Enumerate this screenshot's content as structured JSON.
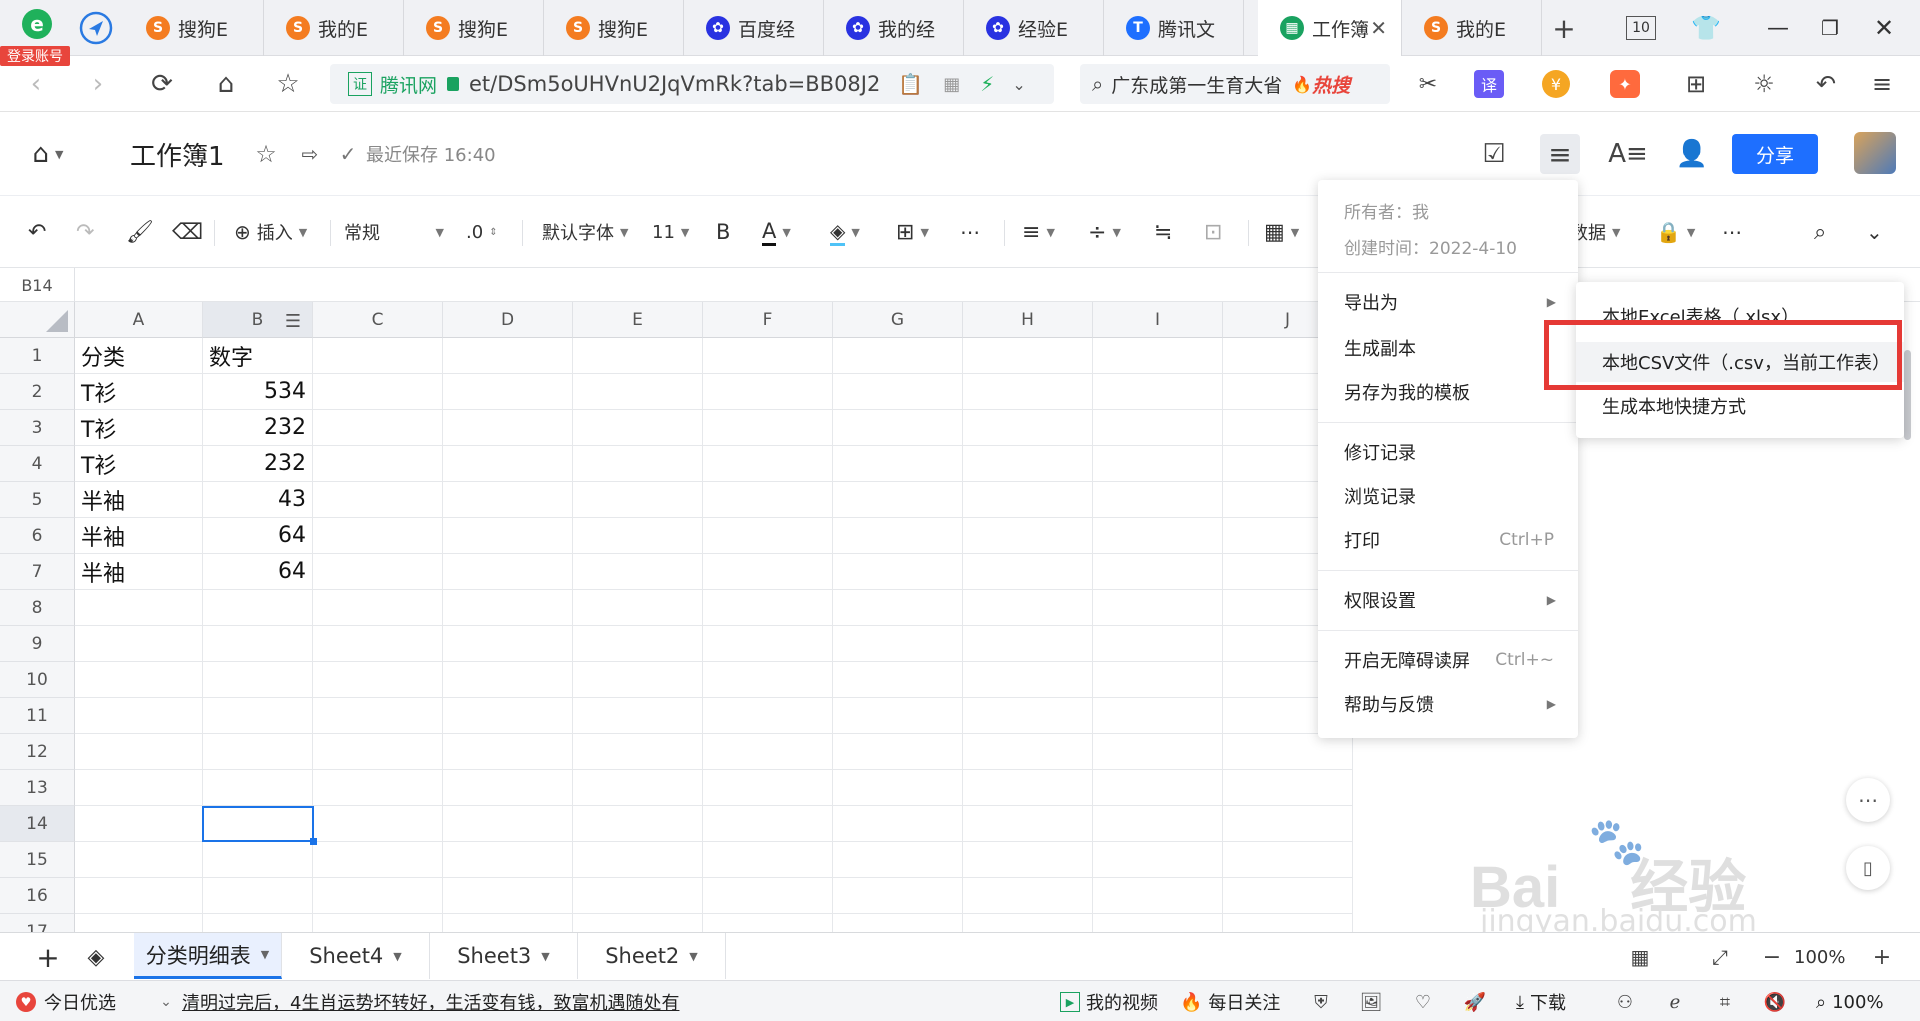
{
  "browser": {
    "login_badge": "登录账号",
    "tabs": [
      {
        "label": "搜狗E",
        "icon_color": "#f47c20",
        "icon_text": "S"
      },
      {
        "label": "我的E",
        "icon_color": "#f47c20",
        "icon_text": "S"
      },
      {
        "label": "搜狗E",
        "icon_color": "#f47c20",
        "icon_text": "S"
      },
      {
        "label": "搜狗E",
        "icon_color": "#f47c20",
        "icon_text": "S"
      },
      {
        "label": "百度经",
        "icon_color": "#2932e1",
        "icon_text": "✿"
      },
      {
        "label": "我的经",
        "icon_color": "#2932e1",
        "icon_text": "✿"
      },
      {
        "label": "经验E",
        "icon_color": "#2932e1",
        "icon_text": "✿"
      },
      {
        "label": "腾讯文",
        "icon_color": "#1e6fff",
        "icon_text": "T"
      },
      {
        "label": "工作簿",
        "icon_color": "#1aa260",
        "icon_text": "▦",
        "active": true
      },
      {
        "label": "我的E",
        "icon_color": "#f47c20",
        "icon_text": "S"
      }
    ],
    "tab_count": "10",
    "url_cert": "证",
    "url_site": "腾讯网",
    "url_text": "et/DSm5oUHVnU2JqVmRk?tab=BB08J2",
    "search_text": "广东成第一生育大省",
    "search_hot": "热搜",
    "translate_label": "译"
  },
  "doc": {
    "title": "工作簿1",
    "save_status": "最近保存 16:40",
    "share_label": "分享"
  },
  "toolbar": {
    "insert_label": "插入",
    "format_label": "常规",
    "decimal_label": ".0",
    "font_label": "默认字体",
    "size_label": "11",
    "bold_label": "B",
    "font_color_label": "A",
    "data_label": "数据"
  },
  "formula_bar": {
    "cell_ref": "B14"
  },
  "grid": {
    "columns": [
      "A",
      "B",
      "C",
      "D",
      "E",
      "F",
      "G",
      "H",
      "I",
      "J"
    ],
    "rows": [
      "1",
      "2",
      "3",
      "4",
      "5",
      "6",
      "7",
      "8",
      "9",
      "10",
      "11",
      "12",
      "13",
      "14",
      "15",
      "16",
      "17"
    ],
    "cells": [
      [
        "分类",
        "数字"
      ],
      [
        "T衫",
        "534"
      ],
      [
        "T衫",
        "232"
      ],
      [
        "T衫",
        "232"
      ],
      [
        "半袖",
        "43"
      ],
      [
        "半袖",
        "64"
      ],
      [
        "半袖",
        "64"
      ]
    ]
  },
  "main_menu": {
    "owner": "所有者：我",
    "created": "创建时间：2022-4-10",
    "items": [
      {
        "label": "导出为",
        "has_submenu": true
      },
      {
        "label": "生成副本"
      },
      {
        "label": "另存为我的模板"
      },
      {
        "label": "修订记录"
      },
      {
        "label": "浏览记录"
      },
      {
        "label": "打印",
        "shortcut": "Ctrl+P"
      },
      {
        "label": "权限设置",
        "has_submenu": true
      },
      {
        "label": "开启无障碍读屏",
        "shortcut": "Ctrl+~"
      },
      {
        "label": "帮助与反馈",
        "has_submenu": true
      }
    ]
  },
  "export_submenu": {
    "items": [
      {
        "label": "本地Excel表格（.xlsx）"
      },
      {
        "label": "本地CSV文件（.csv，当前工作表）"
      },
      {
        "label": "生成本地快捷方式"
      }
    ]
  },
  "sheets": [
    {
      "label": "分类明细表",
      "active": true
    },
    {
      "label": "Sheet4"
    },
    {
      "label": "Sheet3"
    },
    {
      "label": "Sheet2"
    }
  ],
  "sheet_zoom": "100%",
  "status": {
    "today_label": "今日优选",
    "news_text": "清明过完后，4生肖运势坏转好，生活变有钱，致富机遇随处有",
    "video_label": "我的视频",
    "follow_label": "每日关注",
    "download_label": "下载",
    "zoom_label": "100%"
  },
  "watermark": {
    "logo_text": "Bai",
    "brand_suffix": "经验",
    "url": "jingyan.baidu.com"
  },
  "colors": {
    "accent": "#1a73e8",
    "highlight_box": "#e53935",
    "share_bg": "#1e6fff"
  }
}
